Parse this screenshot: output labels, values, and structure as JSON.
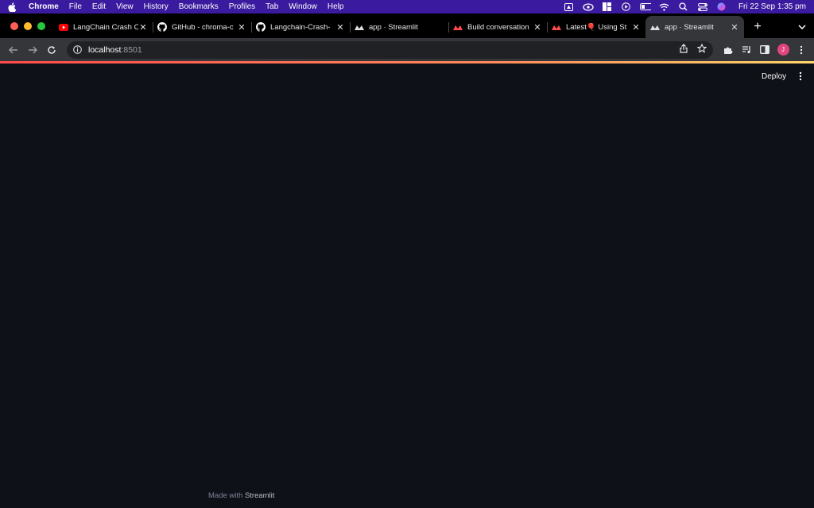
{
  "menubar": {
    "app": "Chrome",
    "items": [
      "File",
      "Edit",
      "View",
      "History",
      "Bookmarks",
      "Profiles",
      "Tab",
      "Window",
      "Help"
    ],
    "clock": "Fri 22 Sep  1:35 pm"
  },
  "tabs": [
    {
      "title": "LangChain Crash C",
      "icon": "youtube-icon"
    },
    {
      "title": "GitHub - chroma-c",
      "icon": "github-icon"
    },
    {
      "title": "Langchain-Crash-",
      "icon": "github-icon"
    },
    {
      "title": "app · Streamlit",
      "icon": "streamlit-icon"
    },
    {
      "title": "Build conversation",
      "icon": "streamlit-icon"
    },
    {
      "title": "Latest🎈 Using St",
      "icon": "streamlit-icon"
    },
    {
      "title": "app · Streamlit",
      "icon": "streamlit-icon",
      "active": true
    }
  ],
  "address": {
    "host": "localhost",
    "port": ":8501"
  },
  "avatar_letter": "J",
  "page": {
    "deploy_label": "Deploy",
    "footer_prefix": "Made with ",
    "footer_brand": "Streamlit"
  },
  "colors": {
    "accent": "#ff4b4b",
    "background": "#0e1117",
    "menubar": "#3a1a9e"
  }
}
